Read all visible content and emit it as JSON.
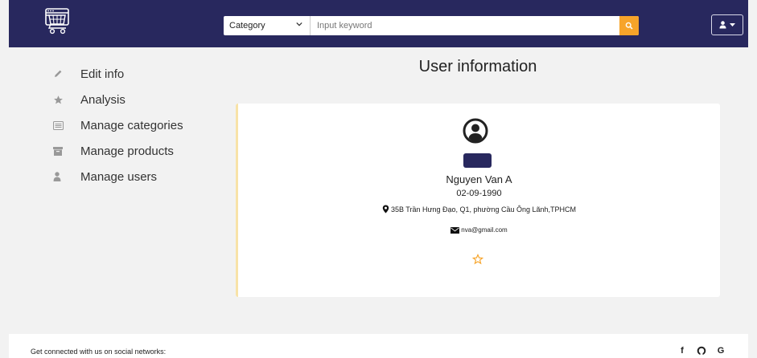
{
  "header": {
    "category_select": "Category",
    "search_placeholder": "Input keyword"
  },
  "sidebar": {
    "items": [
      {
        "label": "Edit info",
        "icon": "pencil-icon"
      },
      {
        "label": "Analysis",
        "icon": "star-icon"
      },
      {
        "label": "Manage categories",
        "icon": "list-icon"
      },
      {
        "label": "Manage products",
        "icon": "archive-icon"
      },
      {
        "label": "Manage users",
        "icon": "user-icon"
      }
    ]
  },
  "main": {
    "title": "User information",
    "user": {
      "name": "Nguyen Van A",
      "dob": "02-09-1990",
      "address": "35B Trần Hưng Đạo, Q1, phường Cầu Ông Lãnh,TPHCM",
      "email": "nva@gmail.com"
    }
  },
  "footer": {
    "text": "Get connected with us on social networks:",
    "socials": [
      "f",
      "G"
    ]
  },
  "colors": {
    "navbar": "#28285e",
    "accent": "#f7a42a",
    "card_border": "#f8e3a8"
  }
}
